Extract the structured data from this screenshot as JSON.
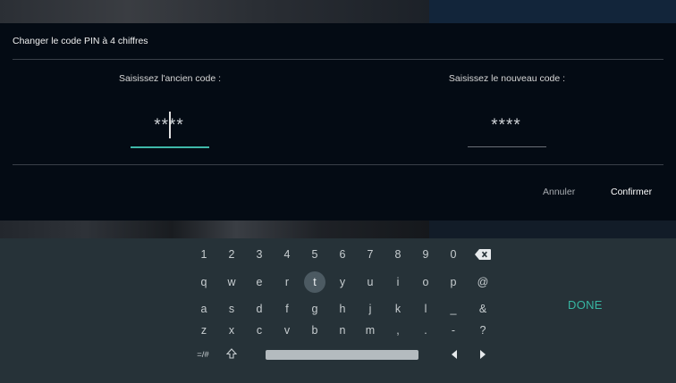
{
  "dialog": {
    "title": "Changer le code PIN à 4 chiffres",
    "old_label": "Saisissez l'ancien code :",
    "new_label": "Saisissez le nouveau code :",
    "old_value": "****",
    "new_value": "****",
    "cancel": "Annuler",
    "confirm": "Confirmer"
  },
  "keyboard": {
    "row1": [
      "1",
      "2",
      "3",
      "4",
      "5",
      "6",
      "7",
      "8",
      "9",
      "0"
    ],
    "row2": [
      "q",
      "w",
      "e",
      "r",
      "t",
      "y",
      "u",
      "i",
      "o",
      "p",
      "@"
    ],
    "row3": [
      "a",
      "s",
      "d",
      "f",
      "g",
      "h",
      "j",
      "k",
      "l",
      "_",
      "&"
    ],
    "row4": [
      "z",
      "x",
      "c",
      "v",
      "b",
      "n",
      "m",
      ",",
      ".",
      "-",
      "?"
    ],
    "symbols": "=/#",
    "done": "DONE",
    "selected_key": "t",
    "icons": [
      "backspace-icon",
      "shift-icon",
      "arrow-left-icon",
      "arrow-right-icon"
    ]
  },
  "colors": {
    "accent": "#3fb8a9",
    "keyboard_bg": "#263238",
    "dialog_bg": "#040b14"
  }
}
